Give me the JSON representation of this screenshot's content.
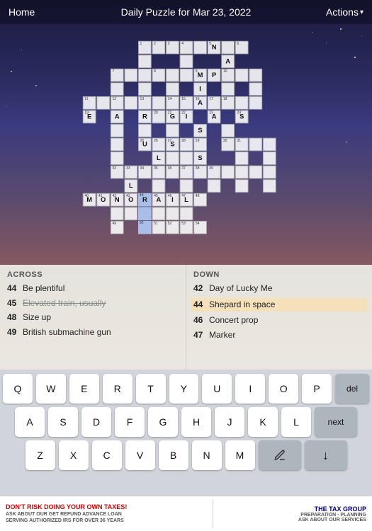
{
  "navbar": {
    "home_label": "Home",
    "title": "Daily Puzzle for Mar 23, 2022",
    "actions_label": "Actions"
  },
  "clues": {
    "across_header": "ACROSS",
    "down_header": "DOWN",
    "across_items": [
      {
        "number": "44",
        "text": "Be plentiful",
        "strikethrough": false,
        "highlighted": false
      },
      {
        "number": "45",
        "text": "Elevated train, usually",
        "strikethrough": true,
        "highlighted": false
      },
      {
        "number": "48",
        "text": "Size up",
        "strikethrough": false,
        "highlighted": false
      },
      {
        "number": "49",
        "text": "British submachine gun",
        "strikethrough": false,
        "highlighted": false
      }
    ],
    "down_items": [
      {
        "number": "42",
        "text": "Day of Lucky Me",
        "strikethrough": false,
        "highlighted": false
      },
      {
        "number": "44",
        "text": "Shepard in space",
        "strikethrough": false,
        "highlighted": true
      },
      {
        "number": "46",
        "text": "Concert prop",
        "strikethrough": false,
        "highlighted": false
      },
      {
        "number": "47",
        "text": "Marker",
        "strikethrough": false,
        "highlighted": false
      }
    ]
  },
  "keyboard": {
    "rows": [
      [
        "Q",
        "W",
        "E",
        "R",
        "T",
        "Y",
        "U",
        "I",
        "O",
        "P"
      ],
      [
        "A",
        "S",
        "D",
        "F",
        "G",
        "H",
        "J",
        "K",
        "L"
      ],
      [
        "Z",
        "X",
        "C",
        "V",
        "B",
        "N",
        "M"
      ]
    ],
    "del_label": "del",
    "next_label": "next",
    "down_arrow": "↓"
  },
  "ad": {
    "left_title": "DON'T RISK DOING YOUR OWN TAXES!",
    "left_sub1": "ASK ABOUT OUR GET REFUND ADVANCE LOAN",
    "left_tagline": "SERVING AUTHORIZED IRS FOR OVER 36 YEARS",
    "right_title": "THE TAX GROUP",
    "right_sub1": "PREPARATION · PLANNING",
    "right_sub2": "ASK ABOUT OUR SERVICES"
  },
  "colors": {
    "bg_dark": "#1a1a3e",
    "bg_accent": "#c47a4a",
    "cell_white": "rgba(255,255,255,0.88)",
    "cell_highlighted": "rgba(255,220,150,0.85)",
    "clues_bg": "rgba(235,235,230,0.95)"
  }
}
